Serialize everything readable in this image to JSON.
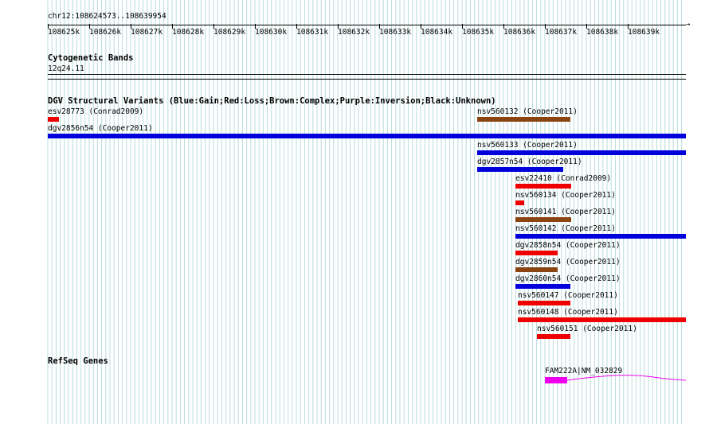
{
  "header": {
    "locus": "chr12:108624573..108639954"
  },
  "ruler": {
    "ticks": [
      "108625k",
      "108626k",
      "108627k",
      "108628k",
      "108629k",
      "108630k",
      "108631k",
      "108632k",
      "108633k",
      "108634k",
      "108635k",
      "108636k",
      "108637k",
      "108638k",
      "108639k"
    ]
  },
  "tracks": {
    "cytoband": {
      "title": "Cytogenetic Bands",
      "band": "12q24.11"
    },
    "dgv": {
      "title": "DGV Structural Variants (Blue:Gain;Red:Loss;Brown:Complex;Purple:Inversion;Black:Unknown)",
      "features": [
        {
          "label": "esv28773 (Conrad2009)",
          "type": "loss"
        },
        {
          "label": "nsv560132 (Cooper2011)",
          "type": "complex"
        },
        {
          "label": "dgv2856n54 (Cooper2011)",
          "type": "gain"
        },
        {
          "label": "nsv560133 (Cooper2011)",
          "type": "gain"
        },
        {
          "label": "dgv2857n54 (Cooper2011)",
          "type": "gain"
        },
        {
          "label": "esv22410 (Conrad2009)",
          "type": "loss"
        },
        {
          "label": "nsv560134 (Cooper2011)",
          "type": "loss"
        },
        {
          "label": "nsv560141 (Cooper2011)",
          "type": "complex"
        },
        {
          "label": "nsv560142 (Cooper2011)",
          "type": "gain"
        },
        {
          "label": "dgv2858n54 (Cooper2011)",
          "type": "loss"
        },
        {
          "label": "dgv2859n54 (Cooper2011)",
          "type": "complex"
        },
        {
          "label": "dgv2860n54 (Cooper2011)",
          "type": "gain"
        },
        {
          "label": "nsv560147 (Cooper2011)",
          "type": "loss"
        },
        {
          "label": "nsv560148 (Cooper2011)",
          "type": "loss"
        },
        {
          "label": "nsv560151 (Cooper2011)",
          "type": "loss"
        }
      ]
    },
    "refseq": {
      "title": "RefSeq Genes",
      "gene_label": "FAM222A|NM_032829"
    }
  },
  "colors": {
    "gain": "#0000dd",
    "loss": "#ee0000",
    "complex": "#8b4513",
    "gene": "#ee00ee",
    "grid": "#b8dcdc"
  }
}
